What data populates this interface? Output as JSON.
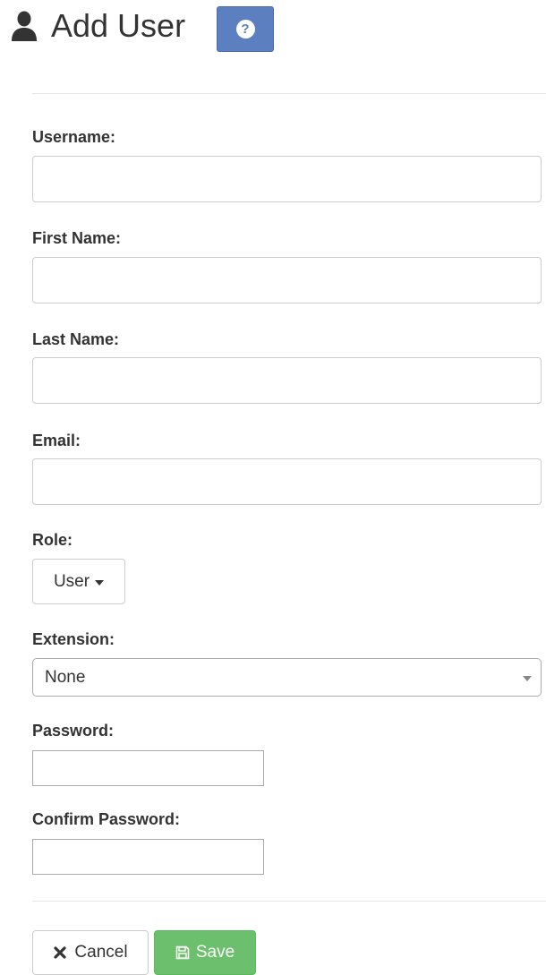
{
  "header": {
    "title": "Add User",
    "help_glyph": "?",
    "icons": {
      "user": "user-icon",
      "help": "question-circle-icon"
    }
  },
  "form": {
    "username_label": "Username:",
    "first_name_label": "First Name:",
    "last_name_label": "Last Name:",
    "email_label": "Email:",
    "role_label": "Role:",
    "role_value": "User",
    "extension_label": "Extension:",
    "extension_value": "None",
    "password_label": "Password:",
    "confirm_password_label": "Confirm Password:",
    "username_value": "",
    "first_name_value": "",
    "last_name_value": "",
    "email_value": "",
    "password_value": "",
    "confirm_password_value": ""
  },
  "actions": {
    "cancel_label": "Cancel",
    "save_label": "Save",
    "icons": {
      "cancel": "times-icon",
      "save": "floppy-disk-icon"
    }
  },
  "colors": {
    "help_button": "#5b7fbf",
    "save_button": "#6cbf6c",
    "text": "#333333",
    "border": "#cccccc"
  }
}
